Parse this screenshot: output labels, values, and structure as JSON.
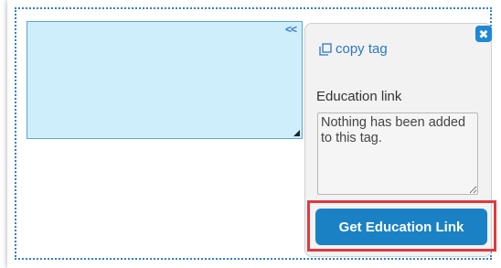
{
  "tag_area": {
    "collapse_label": "<<"
  },
  "panel": {
    "close_icon_glyph": "✖",
    "copy_tag_label": "copy tag",
    "copy_icon": "copy-icon",
    "education_link_label": "Education link",
    "education_link_value": "Nothing has been added to this tag.",
    "get_link_button_label": "Get Education Link"
  },
  "colors": {
    "accent": "#1a82c4",
    "highlight": "#e0393e",
    "tag_fill": "#cdeefa"
  }
}
